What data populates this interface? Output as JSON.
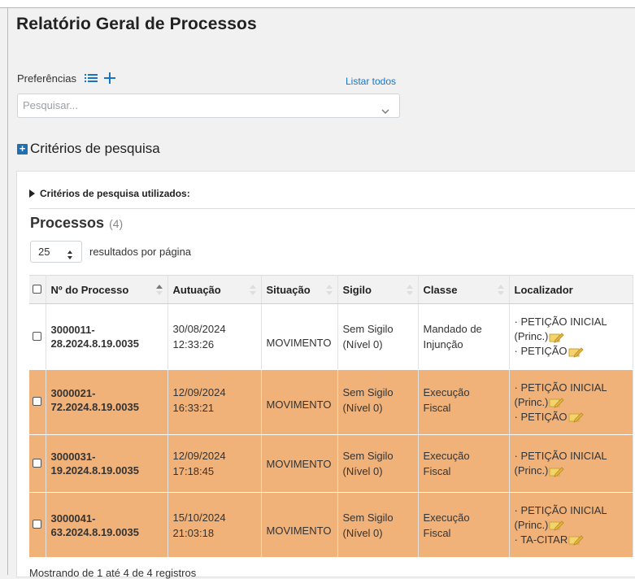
{
  "page": {
    "title": "Relatório Geral de Processos"
  },
  "preferences": {
    "label": "Preferências",
    "list_icon": "list-icon",
    "add_icon": "plus-icon",
    "list_all": "Listar todos"
  },
  "search": {
    "placeholder": "Pesquisar..."
  },
  "criteria": {
    "title": "Critérios de pesquisa",
    "used_label": "Critérios de pesquisa utilizados:"
  },
  "results": {
    "title": "Processos",
    "count": "(4)",
    "page_size": "25",
    "page_size_label": "resultados por página",
    "footer": "Mostrando de 1 até 4 de 4 registros"
  },
  "table": {
    "columns": [
      "Nº do Processo",
      "Autuação",
      "Situação",
      "Sigilo",
      "Classe",
      "Localizador"
    ],
    "rows": [
      {
        "num1": "3000011-",
        "num2": "28.2024.8.19.0035",
        "date": "30/08/2024",
        "time": "12:33:26",
        "situacao": "MOVIMENTO",
        "sigilo1": "Sem Sigilo",
        "sigilo2": "(Nível 0)",
        "classe1": "Mandado de",
        "classe2": "Injunção",
        "loc1": "· PETIÇÃO INICIAL",
        "loc2": "(Princ.)",
        "loc3": "· PETIÇÃO",
        "highlight": false
      },
      {
        "num1": "3000021-",
        "num2": "72.2024.8.19.0035",
        "date": "12/09/2024",
        "time": "16:33:21",
        "situacao": "MOVIMENTO",
        "sigilo1": "Sem Sigilo",
        "sigilo2": "(Nível 0)",
        "classe1": "Execução",
        "classe2": "Fiscal",
        "loc1": "· PETIÇÃO INICIAL",
        "loc2": "(Princ.)",
        "loc3": "· PETIÇÃO",
        "highlight": true
      },
      {
        "num1": "3000031-",
        "num2": "19.2024.8.19.0035",
        "date": "12/09/2024",
        "time": "17:18:45",
        "situacao": "MOVIMENTO",
        "sigilo1": "Sem Sigilo",
        "sigilo2": "(Nível 0)",
        "classe1": "Execução",
        "classe2": "Fiscal",
        "loc1": "· PETIÇÃO INICIAL",
        "loc2": "(Princ.)",
        "loc3": "",
        "highlight": true
      },
      {
        "num1": "3000041-",
        "num2": "63.2024.8.19.0035",
        "date": "15/10/2024",
        "time": "21:03:18",
        "situacao": "MOVIMENTO",
        "sigilo1": "Sem Sigilo",
        "sigilo2": "(Nível 0)",
        "classe1": "Execução",
        "classe2": "Fiscal",
        "loc1": "· PETIÇÃO INICIAL",
        "loc2": "(Princ.)",
        "loc3": "· TA-CITAR",
        "highlight": true
      }
    ]
  },
  "colors": {
    "highlight_row": "#f1b27a",
    "link": "#1a73c7",
    "accent": "#1f6fb3"
  }
}
